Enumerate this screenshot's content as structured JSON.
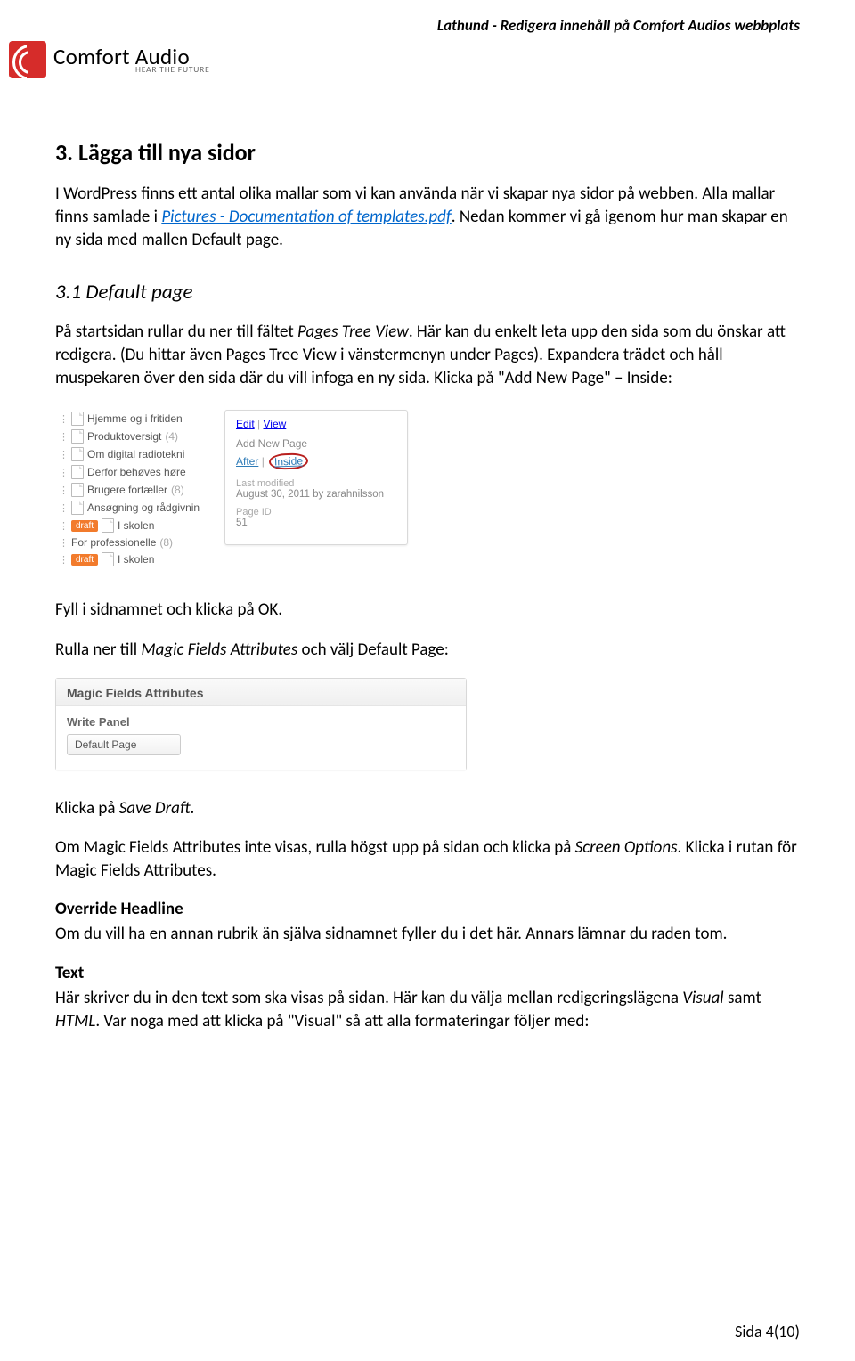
{
  "header": "Lathund - Redigera innehåll på Comfort Audios webbplats",
  "logo": {
    "name": "Comfort Audio",
    "tagline": "HEAR THE FUTURE"
  },
  "h1": "3.   Lägga till nya sidor",
  "p1_a": "I WordPress finns ett antal olika mallar som vi kan använda när vi skapar nya sidor på webben. Alla mallar finns samlade i ",
  "p1_link": "Pictures - Documentation of templates.pdf",
  "p1_b": ". Nedan kommer vi gå igenom hur man skapar en ny sida med mallen Default page.",
  "h2": "3.1   Default page",
  "p2": "På startsidan rullar du ner till fältet Pages Tree View. Här kan du enkelt leta upp den sida som du önskar att redigera. (Du hittar även Pages Tree View i vänstermenyn under Pages). Expandera trädet och håll muspekaren över den sida där du vill infoga en ny sida. Klicka på \"Add New Page\" – Inside:",
  "tree": [
    {
      "label": "Hjemme og i fritiden"
    },
    {
      "label": "Produktoversigt",
      "count": "(4)"
    },
    {
      "label": "Om digital radiotekni"
    },
    {
      "label": "Derfor behøves høre"
    },
    {
      "label": "Brugere fortæller",
      "count": "(8)"
    },
    {
      "label": "Ansøgning og rådgivnin"
    },
    {
      "label": "I skolen",
      "draft": "draft"
    },
    {
      "label": "For professionelle",
      "count": "(8)",
      "noicon": true
    },
    {
      "label": "I skolen",
      "draft": "draft"
    }
  ],
  "popover": {
    "edit": "Edit",
    "view": "View",
    "addnew": "Add New Page",
    "after": "After",
    "inside": "Inside",
    "lastmod_lbl": "Last modified",
    "lastmod": "August 30, 2011 by zarahnilsson",
    "pageid_lbl": "Page ID",
    "pageid": "51"
  },
  "p3": "Fyll i sidnamnet och klicka på OK.",
  "p4": "Rulla ner till Magic Fields Attributes och välj Default Page:",
  "magic": {
    "title": "Magic Fields Attributes",
    "label": "Write Panel",
    "value": "Default Page"
  },
  "p5": "Klicka på Save Draft.",
  "p6": "Om Magic Fields Attributes inte visas, rulla högst upp på sidan och klicka på Screen Options. Klicka i rutan för Magic Fields Attributes.",
  "oh_head": "Override Headline",
  "oh_body": "Om du vill ha en annan rubrik än själva sidnamnet fyller du i det här. Annars lämnar du raden tom.",
  "text_head": "Text",
  "text_body": "Här skriver du in den text som ska visas på sidan. Här kan du välja mellan redigeringslägena Visual samt HTML. Var noga med att klicka på \"Visual\" så att alla formateringar följer med:",
  "footer": "Sida 4(10)"
}
